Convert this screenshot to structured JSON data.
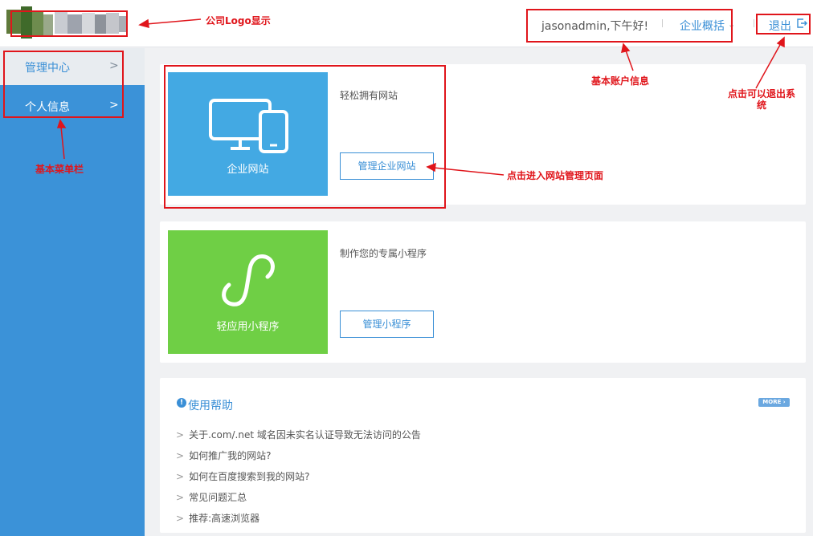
{
  "header": {
    "greeting": "jasonadmin,下午好!",
    "overview_label": "企业概括",
    "logout_label": "退出"
  },
  "sidebar": {
    "items": [
      {
        "label": "管理中心"
      },
      {
        "label": "个人信息"
      }
    ]
  },
  "cards": [
    {
      "tile_label": "企业网站",
      "tile_color": "#43a9e3",
      "description": "轻松拥有网站",
      "button_label": "管理企业网站",
      "icon": "monitor-phone-icon"
    },
    {
      "tile_label": "轻应用小程序",
      "tile_color": "#6fcf45",
      "description": "制作您的专属小程序",
      "button_label": "管理小程序",
      "icon": "mini-program-icon"
    }
  ],
  "help": {
    "title": "使用帮助",
    "more_label": "MORE",
    "items": [
      "关于.com/.net 域名因未实名认证导致无法访问的公告",
      "如何推广我的网站?",
      "如何在百度搜索到我的网站?",
      "常见问题汇总",
      "推荐:高速浏览器"
    ]
  },
  "annotations": {
    "logo": "公司Logo显示",
    "account": "基本账户信息",
    "logout": "点击可以退出系统",
    "menu": "基本菜单栏",
    "enter_site": "点击进入网站管理页面"
  },
  "colors": {
    "accent": "#3a8fd6",
    "sidebar": "#3b92d8",
    "annotation": "#e0151b"
  }
}
